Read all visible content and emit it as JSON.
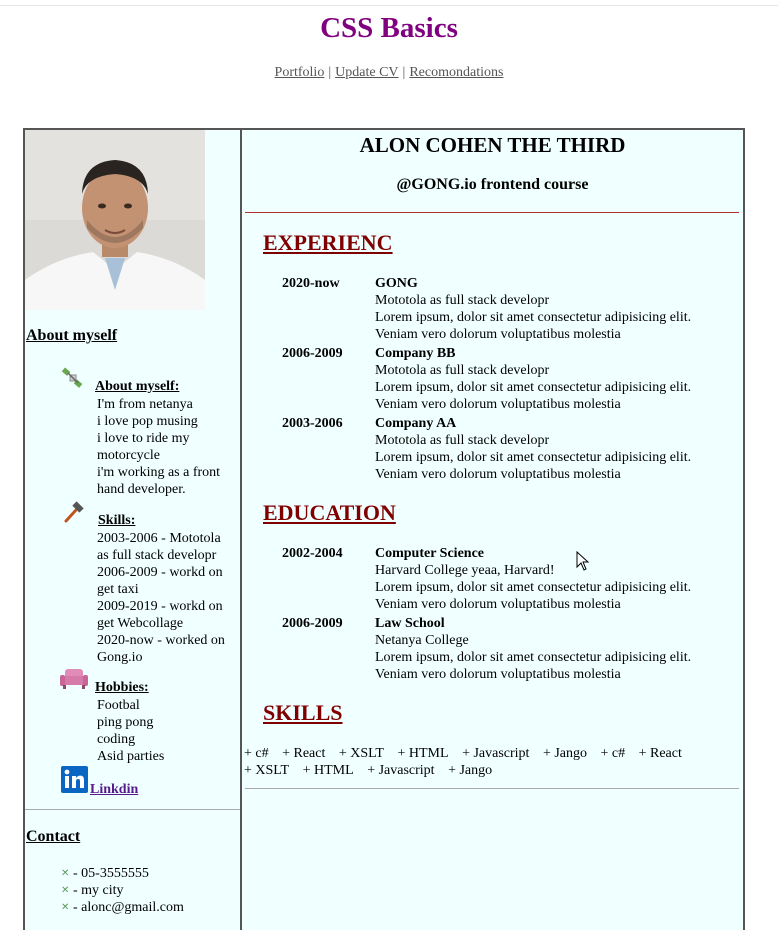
{
  "header": {
    "title": "CSS Basics",
    "nav": [
      "Portfolio",
      "Update CV",
      "Recomondations"
    ],
    "separator": "|"
  },
  "sidebar": {
    "about_heading": "About myself",
    "about": {
      "label": "About myself:",
      "lines": [
        "I'm from netanya",
        "i love pop musing",
        "i love to ride my motorcycle",
        "i'm working as a front hand developer."
      ]
    },
    "skills": {
      "label": "Skills:",
      "lines": [
        "2003-2006 - Mototola as full stack developr",
        "2006-2009 - workd on get taxi",
        "2009-2019 - workd on get Webcollage",
        "2020-now - worked on Gong.io"
      ]
    },
    "hobbies": {
      "label": "Hobbies:",
      "lines": [
        "Footbal",
        "ping pong",
        "coding",
        "Asid parties"
      ]
    },
    "linkedin_label": "Linkdin",
    "contact_heading": "Contact",
    "contact": [
      "- 05-3555555",
      "- my city",
      "- alonc@gmail.com"
    ]
  },
  "main": {
    "name": "ALON COHEN THE THIRD",
    "course": "@GONG.io frontend course",
    "experience_heading": "EXPERIENC",
    "experience": [
      {
        "years": "2020-now",
        "company": "GONG",
        "role": "Mototola as full stack developr",
        "desc": "Lorem ipsum, dolor sit amet consectetur adipisicing elit. Veniam vero dolorum voluptatibus molestia"
      },
      {
        "years": "2006-2009",
        "company": "Company BB",
        "role": "Mototola as full stack developr",
        "desc": "Lorem ipsum, dolor sit amet consectetur adipisicing elit. Veniam vero dolorum voluptatibus molestia"
      },
      {
        "years": "2003-2006",
        "company": "Company AA",
        "role": "Mototola as full stack developr",
        "desc": "Lorem ipsum, dolor sit amet consectetur adipisicing elit. Veniam vero dolorum voluptatibus molestia"
      }
    ],
    "education_heading": "EDUCATION",
    "education": [
      {
        "years": "2002-2004",
        "company": "Computer Science",
        "role": "Harvard College yeaa, Harvard!",
        "desc": "Lorem ipsum, dolor sit amet consectetur adipisicing elit. Veniam vero dolorum voluptatibus molestia"
      },
      {
        "years": "2006-2009",
        "company": "Law School",
        "role": "Netanya College",
        "desc": "Lorem ipsum, dolor sit amet consectetur adipisicing elit. Veniam vero dolorum voluptatibus molestia"
      }
    ],
    "skills_heading": "SKILLS",
    "skills": [
      "+ c#",
      "+ React",
      "+ XSLT",
      "+ HTML",
      "+ Javascript",
      "+ Jango",
      "+ c#",
      "+ React",
      "+ XSLT",
      "+ HTML",
      "+ Javascript",
      "+ Jango"
    ]
  },
  "colors": {
    "title": "#800080",
    "section": "#800000",
    "panel": "#f0ffff",
    "linkedin": "#0a66c2"
  }
}
